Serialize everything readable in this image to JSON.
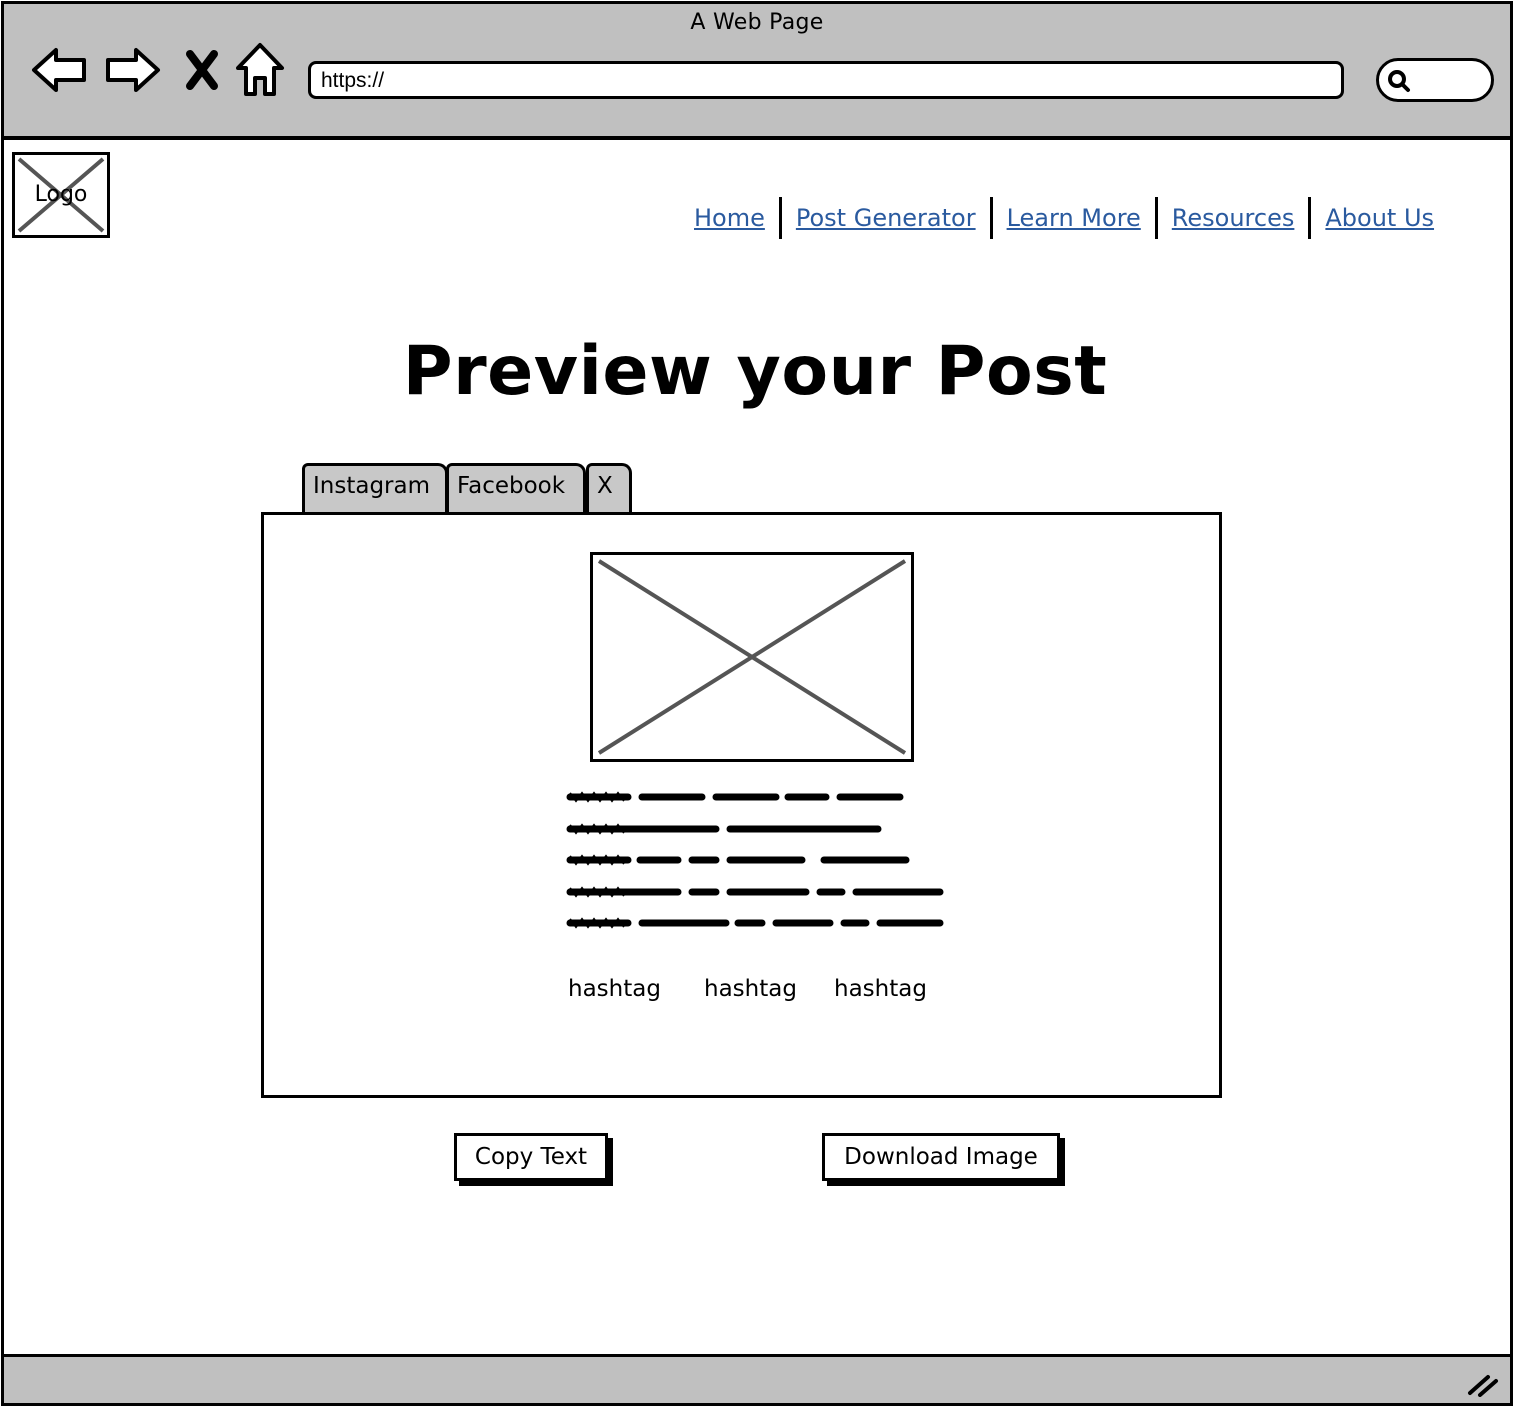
{
  "browser": {
    "window_title": "A Web Page",
    "url": "https://"
  },
  "header": {
    "logo_text": "Logo",
    "nav": [
      "Home",
      "Post Generator",
      "Learn More",
      "Resources",
      "About Us"
    ]
  },
  "main": {
    "title": "Preview your Post",
    "tabs": [
      "Instagram",
      "Facebook",
      "X"
    ],
    "hashtags": [
      "hashtag",
      "hashtag",
      "hashtag"
    ],
    "actions": {
      "copy_label": "Copy Text",
      "download_label": "Download Image"
    }
  },
  "icons": [
    "back-arrow-icon",
    "forward-arrow-icon",
    "stop-icon",
    "home-icon",
    "search-icon",
    "image-placeholder-icon",
    "resize-grip-icon"
  ],
  "colors": {
    "chrome": "#c0c0c0",
    "link": "#2a5a9f",
    "tab": "#c8c8c8"
  }
}
